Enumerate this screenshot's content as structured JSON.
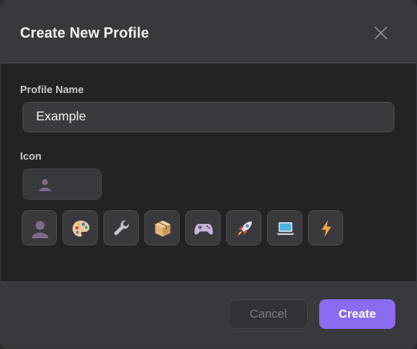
{
  "dialog": {
    "title": "Create New Profile",
    "close_icon": "close-icon"
  },
  "form": {
    "profile_name_label": "Profile Name",
    "profile_name_value": "Example",
    "icon_label": "Icon",
    "selected_icon": "person-silhouette-icon",
    "icon_options": [
      "person-silhouette-icon",
      "artist-palette-icon",
      "wrench-icon",
      "package-box-icon",
      "game-controller-icon",
      "rocket-icon",
      "laptop-icon",
      "lightning-bolt-icon"
    ]
  },
  "footer": {
    "cancel_label": "Cancel",
    "create_label": "Create"
  },
  "colors": {
    "accent": "#8b6cf0",
    "header_bg": "#39383c",
    "body_bg": "#232225"
  }
}
